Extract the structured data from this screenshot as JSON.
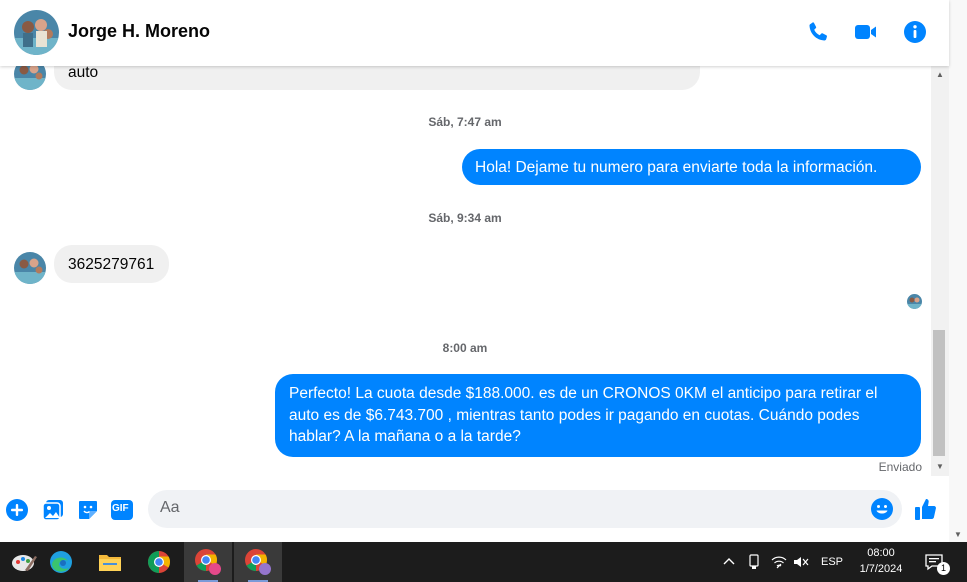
{
  "contact": {
    "name": "Jorge H. Moreno"
  },
  "header_icons": [
    "phone-icon",
    "video-icon",
    "info-icon"
  ],
  "messages": {
    "m1_text": "auto",
    "ts1": "Sáb, 7:47 am",
    "m2_text": "Hola! Dejame tu numero  para enviarte toda la información.",
    "ts2": "Sáb, 9:34 am",
    "m3_text": "3625279761",
    "ts3": "8:00 am",
    "m4_line1": "Perfecto! La cuota desde $188.000. es de un CRONOS 0KM el anticipo para retirar el",
    "m4_line2": "auto es de $6.743.700 , mientras tanto podes ir pagando en cuotas. Cuándo podes",
    "m4_line3": "hablar? A la mañana o a la tarde?",
    "status": "Enviado"
  },
  "composer": {
    "placeholder": "Aa",
    "gif_label": "GIF"
  },
  "taskbar": {
    "language": "ESP",
    "time": "08:00",
    "date": "1/7/2024",
    "notification_count": "1"
  },
  "colors": {
    "accent": "#0084ff",
    "bubble_in": "#f0f0f0",
    "timestamp": "#65676b",
    "taskbar": "#1c1c1c"
  }
}
